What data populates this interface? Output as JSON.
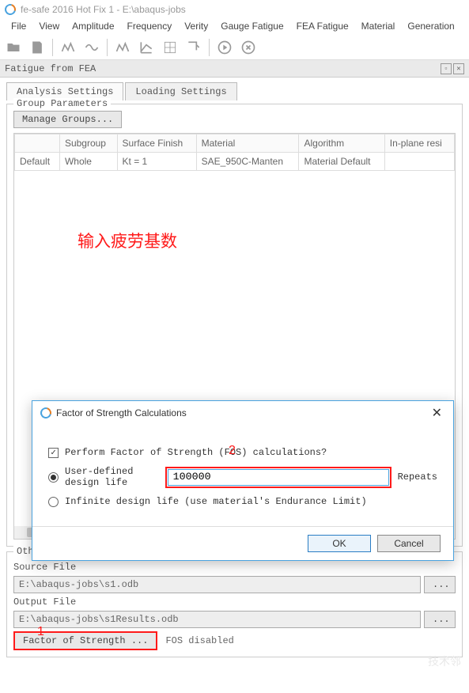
{
  "window": {
    "title": "fe-safe 2016 Hot Fix 1 - E:\\abaqus-jobs"
  },
  "menu": {
    "items": [
      "File",
      "View",
      "Amplitude",
      "Frequency",
      "Verity",
      "Gauge Fatigue",
      "FEA Fatigue",
      "Material",
      "Generation"
    ]
  },
  "panel": {
    "title": "Fatigue from FEA"
  },
  "tabs": {
    "items": [
      "Analysis Settings",
      "Loading Settings"
    ],
    "active": 0
  },
  "group": {
    "legend": "Group Parameters",
    "manage_btn": "Manage Groups...",
    "columns": [
      "",
      "Subgroup",
      "Surface Finish",
      "Material",
      "Algorithm",
      "In-plane resi"
    ],
    "rows": [
      [
        "Default",
        "Whole",
        "Kt = 1",
        "SAE_950C-Manten",
        "Material Default",
        ""
      ]
    ]
  },
  "annotation": {
    "main_text": "输入疲劳基数",
    "num1": "1",
    "num2": "2"
  },
  "other": {
    "legend": "Other Options",
    "source_label": "Source File",
    "source_value": "E:\\abaqus-jobs\\s1.odb",
    "output_label": "Output File",
    "output_value": "E:\\abaqus-jobs\\s1Results.odb",
    "fos_btn": "Factor of Strength ...",
    "fos_status": "FOS disabled",
    "dots": "..."
  },
  "dialog": {
    "title": "Factor of Strength Calculations",
    "checkbox_label": "Perform Factor of Strength (FOS) calculations?",
    "checkbox_checked": true,
    "radio_user_label": "User-defined design life",
    "user_value": "100000",
    "user_unit": "Repeats",
    "radio_inf_label": "Infinite design life (use material's Endurance Limit)",
    "ok": "OK",
    "cancel": "Cancel"
  },
  "watermark": "技术邻"
}
